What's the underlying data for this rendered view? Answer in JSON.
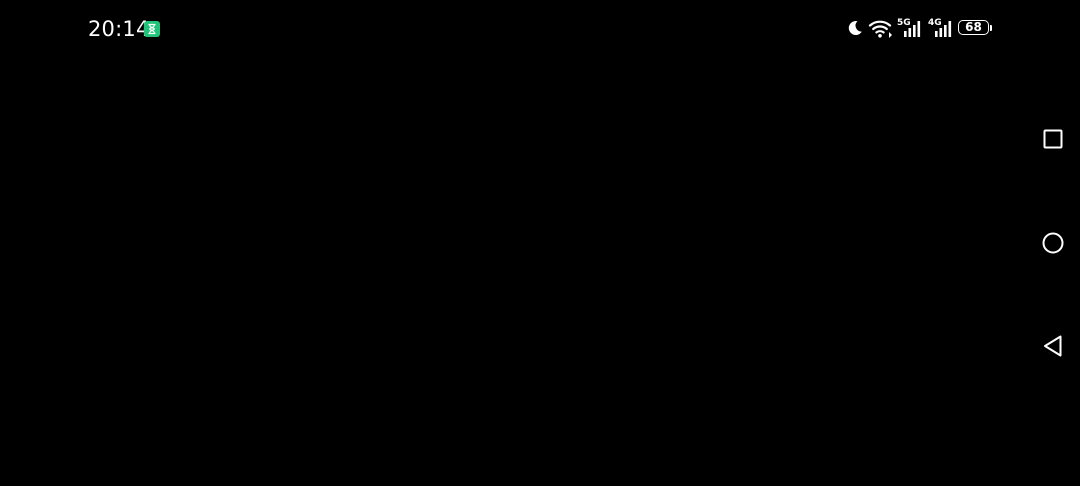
{
  "status_bar": {
    "time": "20:14",
    "app_badge_icon": "hourglass-icon",
    "app_badge_color": "#21c47a",
    "icons": [
      "moon-icon",
      "wifi-icon",
      "signal-5g-icon",
      "signal-4g-icon",
      "battery-icon"
    ],
    "network_1": "5G",
    "network_2": "4G",
    "battery_level": "68"
  },
  "navigation_bar": {
    "buttons": [
      "recents-square-icon",
      "home-circle-icon",
      "back-triangle-icon"
    ]
  },
  "colors": {
    "background": "#000000",
    "foreground": "#ffffff"
  }
}
